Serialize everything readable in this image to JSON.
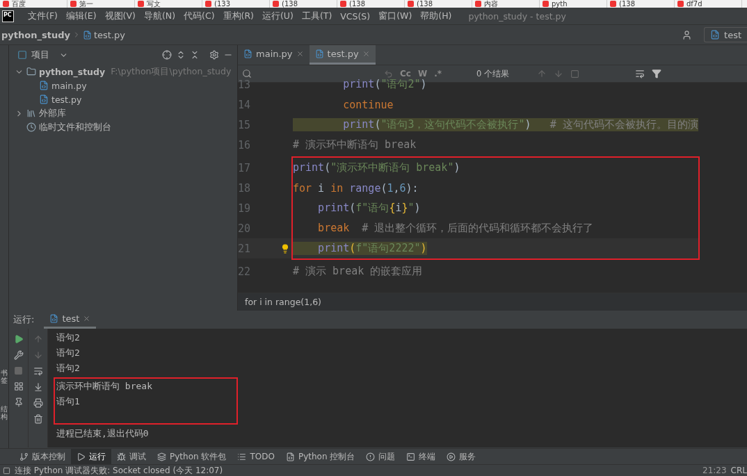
{
  "browser_tabs": [
    "百度",
    "第一",
    "写文",
    "(133",
    "(138",
    "(138",
    "(138",
    "内容",
    "pyth",
    "(138",
    "df7d"
  ],
  "menu": {
    "logo": "PC",
    "items": [
      "文件(F)",
      "编辑(E)",
      "视图(V)",
      "导航(N)",
      "代码(C)",
      "重构(R)",
      "运行(U)",
      "工具(T)",
      "VCS(S)",
      "窗口(W)",
      "帮助(H)"
    ],
    "title": "python_study - test.py"
  },
  "navbar": {
    "crumbs": [
      "python_study",
      "test.py"
    ],
    "run_config": "test"
  },
  "side_strip": [
    "书签",
    "结构"
  ],
  "project": {
    "title": "项目",
    "tree": [
      {
        "label": "python_study",
        "path": "F:\\python项目\\python_study",
        "kind": "folder",
        "expanded": true,
        "children": [
          {
            "label": "main.py",
            "kind": "py"
          },
          {
            "label": "test.py",
            "kind": "py"
          }
        ]
      },
      {
        "label": "外部库",
        "kind": "lib",
        "expanded": false
      },
      {
        "label": "临时文件和控制台",
        "kind": "scratch"
      }
    ]
  },
  "editor": {
    "tabs": [
      {
        "label": "main.py",
        "selected": false
      },
      {
        "label": "test.py",
        "selected": true
      }
    ],
    "search": {
      "results": "0 个结果",
      "options": [
        "Cc",
        "W",
        ".*"
      ]
    },
    "sections": [
      {
        "boxed": false,
        "lines": [
          {
            "number": "13",
            "highlight": false,
            "tokens": [
              {
                "kind": "fn",
                "text": "        print"
              },
              {
                "kind": "plain",
                "text": "("
              },
              {
                "kind": "str",
                "text": "\"语句2\""
              },
              {
                "kind": "plain",
                "text": ")"
              }
            ]
          },
          {
            "number": "14",
            "highlight": false,
            "tokens": [
              {
                "kind": "kw",
                "text": "        continue"
              }
            ]
          },
          {
            "number": "15",
            "highlight": true,
            "tokens": [
              {
                "kind": "fn",
                "text": "        print"
              },
              {
                "kind": "plain",
                "text": "("
              },
              {
                "kind": "str",
                "text": "\"语句3，这句代码不会被执行\""
              },
              {
                "kind": "plain",
                "text": ")"
              },
              {
                "kind": "cmt",
                "text": "   # 这句代码不会被执行。目的演"
              }
            ]
          },
          {
            "number": "16",
            "highlight": false,
            "tokens": [
              {
                "kind": "cmt",
                "text": "# 演示环中断语句 break"
              }
            ]
          }
        ]
      },
      {
        "boxed": true,
        "lines": [
          {
            "number": "17",
            "highlight": false,
            "tokens": [
              {
                "kind": "fn",
                "text": "print"
              },
              {
                "kind": "plain",
                "text": "("
              },
              {
                "kind": "str",
                "text": "\"演示环中断语句 break\""
              },
              {
                "kind": "plain",
                "text": ")"
              }
            ]
          },
          {
            "number": "18",
            "highlight": false,
            "tokens": [
              {
                "kind": "kw",
                "text": "for"
              },
              {
                "kind": "plain",
                "text": " i "
              },
              {
                "kind": "kw",
                "text": "in"
              },
              {
                "kind": "fn",
                "text": " range"
              },
              {
                "kind": "plain",
                "text": "("
              },
              {
                "kind": "num",
                "text": "1"
              },
              {
                "kind": "plain",
                "text": ","
              },
              {
                "kind": "num",
                "text": "6"
              },
              {
                "kind": "plain",
                "text": "):"
              }
            ]
          },
          {
            "number": "19",
            "highlight": false,
            "tokens": [
              {
                "kind": "fn",
                "text": "    print"
              },
              {
                "kind": "plain",
                "text": "("
              },
              {
                "kind": "str",
                "text": "f\"语句"
              },
              {
                "kind": "brace",
                "text": "{"
              },
              {
                "kind": "plain",
                "text": "i"
              },
              {
                "kind": "brace",
                "text": "}"
              },
              {
                "kind": "str",
                "text": "\""
              },
              {
                "kind": "plain",
                "text": ")"
              }
            ]
          },
          {
            "number": "20",
            "highlight": false,
            "tokens": [
              {
                "kind": "kw",
                "text": "    break"
              },
              {
                "kind": "cmt",
                "text": "  # 退出整个循环，后面的代码和循环都不会执行了"
              }
            ]
          },
          {
            "number": "21",
            "highlight": true,
            "hint": true,
            "tokens": [
              {
                "kind": "fn",
                "text": "    print"
              },
              {
                "kind": "brace",
                "text": "("
              },
              {
                "kind": "str",
                "text": "f\"语句2222\""
              },
              {
                "kind": "brace",
                "text": ")"
              }
            ]
          }
        ]
      },
      {
        "boxed": false,
        "lines": [
          {
            "number": "22",
            "highlight": false,
            "tokens": [
              {
                "kind": "cmt",
                "text": "# 演示 break 的嵌套应用"
              }
            ]
          }
        ]
      }
    ],
    "breadcrumb": "for i in range(1,6)"
  },
  "run": {
    "label": "运行:",
    "tab": "test",
    "sections": [
      {
        "boxed": false,
        "lines": [
          "语句2",
          "语句2",
          "语句2"
        ]
      },
      {
        "boxed": true,
        "lines": [
          "演示环中断语句 break",
          "语句1"
        ]
      },
      {
        "boxed": false,
        "lines": [
          "进程已结束,退出代码0"
        ]
      }
    ]
  },
  "tool_tabs": [
    {
      "label": "版本控制",
      "selected": false
    },
    {
      "label": "运行",
      "selected": true
    },
    {
      "label": "调试",
      "selected": false
    },
    {
      "label": "Python 软件包",
      "selected": false
    },
    {
      "label": "TODO",
      "selected": false
    },
    {
      "label": "Python 控制台",
      "selected": false
    },
    {
      "label": "问题",
      "selected": false
    },
    {
      "label": "终端",
      "selected": false
    },
    {
      "label": "服务",
      "selected": false
    }
  ],
  "status_bar": {
    "message": "连接 Python 调试器失败: Socket closed (今天 12:07)",
    "position": "21:23",
    "line_ending": "CRL"
  }
}
